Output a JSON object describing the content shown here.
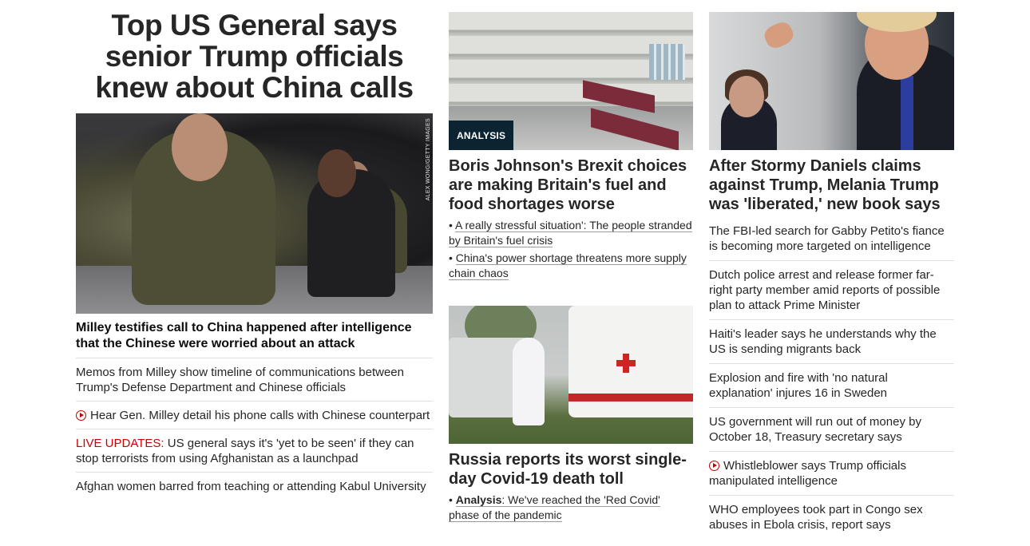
{
  "main": {
    "headline": "Top US General says senior Trump officials knew about China calls",
    "hero_credit": "ALEX WONG/GETTY IMAGES",
    "lead_link": "Milley testifies call to China happened after intelligence that the Chinese were worried about an attack",
    "items": [
      {
        "text": "Memos from Milley show timeline of communications between Trump's Defense Department and Chinese officials"
      },
      {
        "text": "Hear Gen. Milley detail his phone calls with Chinese counterpart",
        "video": true
      },
      {
        "prefix": "LIVE UPDATES:",
        "text": " US general says it's 'yet to be seen' if they can stop terrorists from using Afghanistan as a launchpad"
      },
      {
        "text": "Afghan women barred from teaching or attending Kabul University"
      }
    ]
  },
  "middle": {
    "card1": {
      "badge": "ANALYSIS",
      "title": "Boris Johnson's Brexit choices are making Britain's fuel and food shortages worse",
      "links": [
        "A really stressful situation': The people stranded by Britain's fuel crisis",
        "China's power shortage threatens more supply chain chaos"
      ]
    },
    "card2": {
      "title": "Russia reports its worst single-day Covid-19 death toll",
      "link_bold": "Analysis",
      "link_rest": ": We've reached the 'Red Covid' phase of the pandemic"
    }
  },
  "right": {
    "card": {
      "title": "After Stormy Daniels claims against Trump, Melania Trump was 'liberated,' new book says"
    },
    "items": [
      {
        "text": "The FBI-led search for Gabby Petito's fiance is becoming more targeted on intelligence"
      },
      {
        "text": "Dutch police arrest and release former far-right party member amid reports of possible plan to attack Prime Minister"
      },
      {
        "text": "Haiti's leader says he understands why the US is sending migrants back"
      },
      {
        "text": "Explosion and fire with 'no natural explanation' injures 16 in Sweden"
      },
      {
        "text": "US government will run out of money by October 18, Treasury secretary says"
      },
      {
        "text": "Whistleblower says Trump officials manipulated intelligence",
        "video": true
      },
      {
        "text": "WHO employees took part in Congo sex abuses in Ebola crisis, report says"
      }
    ]
  },
  "colors": {
    "live": "#cc0000",
    "badge_bg": "#0c2431",
    "text": "#262626"
  }
}
